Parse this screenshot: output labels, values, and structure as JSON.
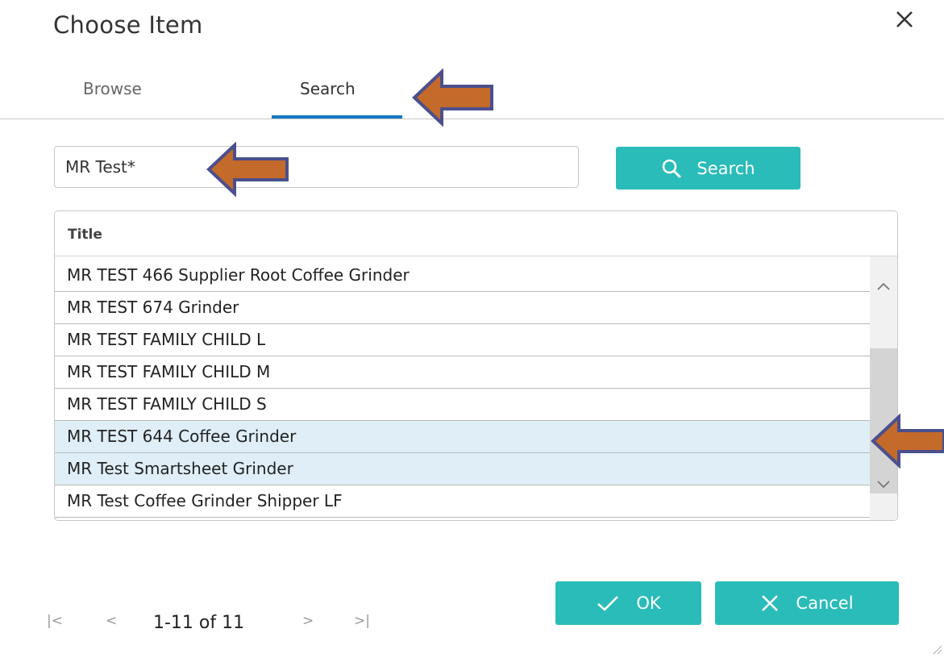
{
  "dialog": {
    "title": "Choose Item",
    "close_icon": "close-icon"
  },
  "tabs": [
    {
      "label": "Browse",
      "active": false
    },
    {
      "label": "Search",
      "active": true
    }
  ],
  "search": {
    "value": "MR Test*",
    "button_label": "Search",
    "button_icon": "search-icon"
  },
  "grid": {
    "column_header": "Title",
    "rows": [
      {
        "title": "MR TEST 466 Supplier Root Coffee Grinder",
        "selected": false
      },
      {
        "title": "MR TEST 674 Grinder",
        "selected": false
      },
      {
        "title": "MR TEST FAMILY CHILD L",
        "selected": false
      },
      {
        "title": "MR TEST FAMILY CHILD M",
        "selected": false
      },
      {
        "title": "MR TEST FAMILY CHILD S",
        "selected": false
      },
      {
        "title": "MR TEST 644 Coffee Grinder",
        "selected": true
      },
      {
        "title": "MR Test Smartsheet Grinder",
        "selected": true
      },
      {
        "title": "MR Test Coffee Grinder Shipper LF",
        "selected": false
      }
    ]
  },
  "pager": {
    "text": "1-11 of 11",
    "first_label": "|<",
    "prev_label": "<",
    "next_label": ">",
    "last_label": ">|"
  },
  "footer": {
    "ok_label": "OK",
    "cancel_label": "Cancel"
  },
  "colors": {
    "accent": "#2abcb8",
    "tab_underline": "#1479c4",
    "selected_row": "#dfeef7",
    "annotation_arrow_fill": "#c46a2a",
    "annotation_arrow_stroke": "#4b4f8c"
  }
}
